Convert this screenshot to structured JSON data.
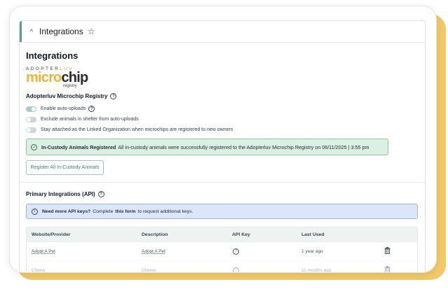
{
  "header": {
    "title": "Integrations"
  },
  "section_title": "Integrations",
  "logo": {
    "top_text_a": "ADOPTER",
    "top_text_b": "LUV",
    "micro": "micro",
    "chip": "chip",
    "registry": "registry"
  },
  "registry": {
    "title": "Adopterluv Microchip Registry",
    "toggles": [
      {
        "label": "Enable auto-uploads",
        "on": true
      },
      {
        "label": "Exclude animals in shelter from auto-uploads",
        "on": false
      },
      {
        "label": "Stay attached as the Linked Organization when microchips are registered to new owners",
        "on": false
      }
    ],
    "alert_bold": "In-Custody Animals Registered",
    "alert_text": "All in-custody animals were successfully registered to the Adopterluv Microchip Registry on 06/11/2025 | 3:55 pm",
    "button": "Register All In-Custody Animals"
  },
  "api": {
    "title": "Primary Integrations (API)",
    "info_bold": "Need more API keys?",
    "info_pre": "Complete",
    "info_link": "this form",
    "info_post": "to request additional keys.",
    "columns": [
      "Website/Provider",
      "Description",
      "API Key",
      "Last Used"
    ],
    "rows": [
      {
        "provider": "Adopt A Pet",
        "description": "Adopt A Pet",
        "last_used": "1 year ago"
      },
      {
        "provider": "Chewy",
        "description": "Chewy",
        "last_used": "11 months ago"
      }
    ]
  },
  "colors": {
    "accent": "#5b9c94",
    "success_bg": "#dcefe3",
    "info_bg": "#dbe6fb",
    "backdrop": "#f2c966"
  }
}
